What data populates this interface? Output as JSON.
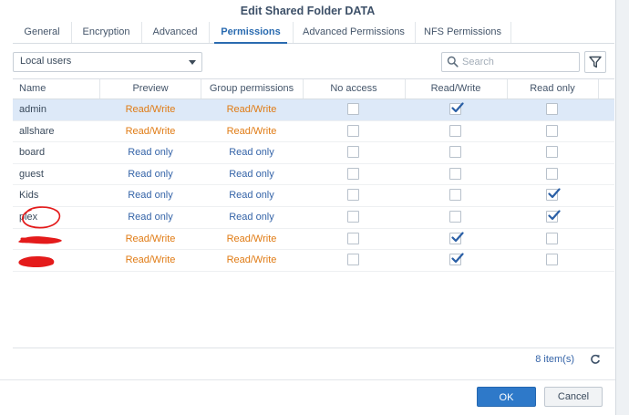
{
  "window": {
    "title": "Edit Shared Folder DATA"
  },
  "tabs": [
    {
      "label": "General",
      "active": false
    },
    {
      "label": "Encryption",
      "active": false
    },
    {
      "label": "Advanced",
      "active": false
    },
    {
      "label": "Permissions",
      "active": true
    },
    {
      "label": "Advanced Permissions",
      "active": false
    },
    {
      "label": "NFS Permissions",
      "active": false
    }
  ],
  "toolbar": {
    "user_type_selected": "Local users",
    "search_placeholder": "Search"
  },
  "table": {
    "columns": [
      "Name",
      "Preview",
      "Group permissions",
      "No access",
      "Read/Write",
      "Read only"
    ],
    "rows": [
      {
        "name": "admin",
        "preview": "Read/Write",
        "group": "Read/Write",
        "no_access": false,
        "read_write": true,
        "read_only": false,
        "selected": true
      },
      {
        "name": "allshare",
        "preview": "Read/Write",
        "group": "Read/Write",
        "no_access": false,
        "read_write": false,
        "read_only": false
      },
      {
        "name": "board",
        "preview": "Read only",
        "group": "Read only",
        "no_access": false,
        "read_write": false,
        "read_only": false
      },
      {
        "name": "guest",
        "preview": "Read only",
        "group": "Read only",
        "no_access": false,
        "read_write": false,
        "read_only": false
      },
      {
        "name": "Kids",
        "preview": "Read only",
        "group": "Read only",
        "no_access": false,
        "read_write": false,
        "read_only": true
      },
      {
        "name": "plex",
        "preview": "Read only",
        "group": "Read only",
        "no_access": false,
        "read_write": false,
        "read_only": true,
        "annotated": true
      },
      {
        "name": "",
        "preview": "Read/Write",
        "group": "Read/Write",
        "no_access": false,
        "read_write": true,
        "read_only": false,
        "redacted": true
      },
      {
        "name": "",
        "preview": "Read/Write",
        "group": "Read/Write",
        "no_access": false,
        "read_write": true,
        "read_only": false,
        "redacted": true
      }
    ]
  },
  "footer": {
    "item_count": "8 item(s)"
  },
  "buttons": {
    "ok": "OK",
    "cancel": "Cancel"
  },
  "colors": {
    "read_write": "#e07b14",
    "read_only": "#3564a8",
    "primary": "#2e79c9",
    "selected_row": "#dde9f8",
    "annotation": "#e41b1b"
  }
}
